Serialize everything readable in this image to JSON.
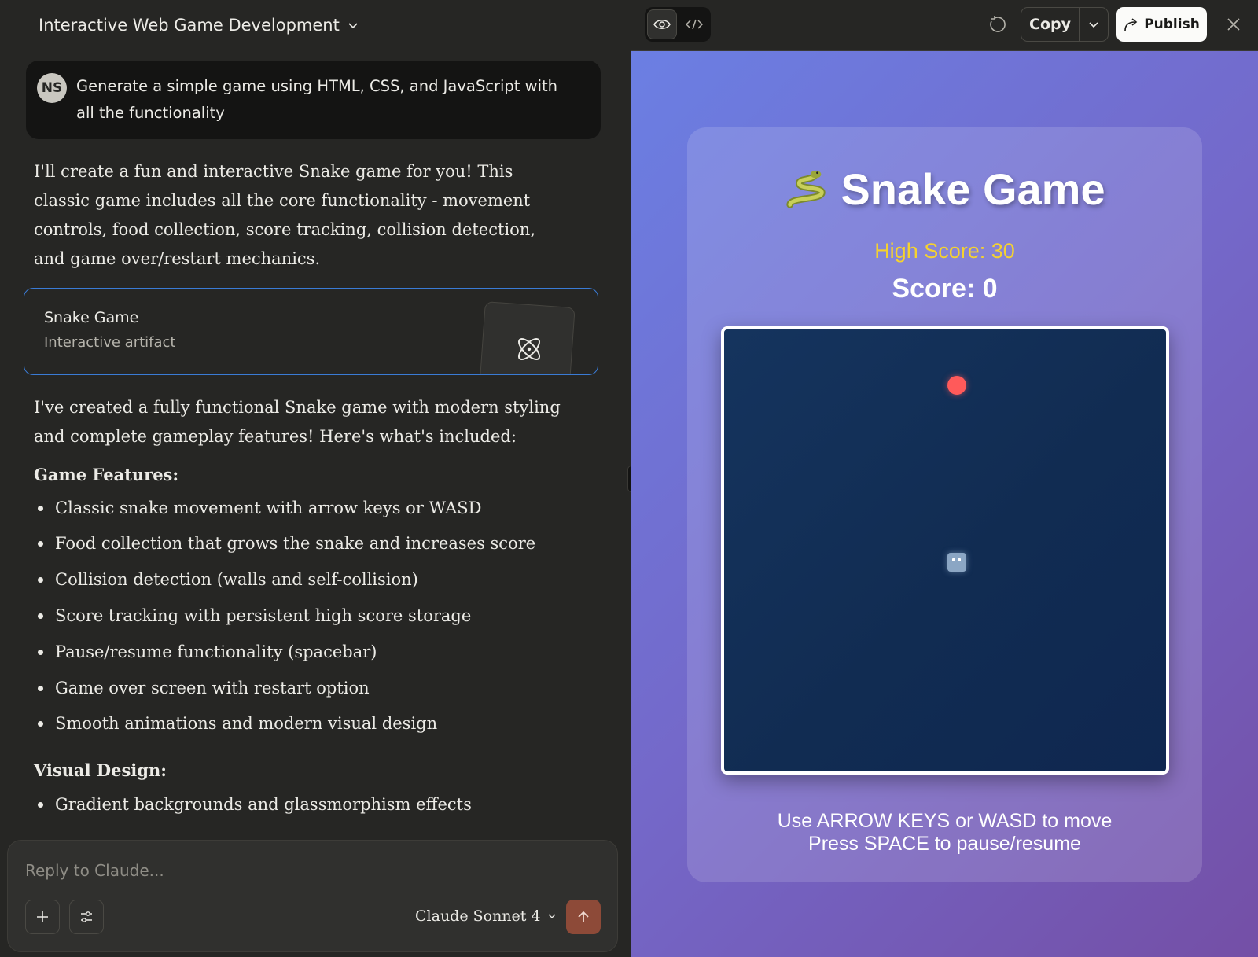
{
  "conversation": {
    "title": "Interactive Web Game Development",
    "user_initials": "NS",
    "user_message": "Generate a simple game using HTML, CSS, and JavaScript with all the functionality",
    "intro": "I'll create a fun and interactive Snake game for you! This classic game includes all the core functionality - movement controls, food collection, score tracking, collision detection, and game over/restart mechanics.",
    "artifact": {
      "title": "Snake Game",
      "subtitle": "Interactive artifact"
    },
    "summary": "I've created a fully functional Snake game with modern styling and complete gameplay features! Here's what's included:",
    "features_heading": "Game Features:",
    "features": [
      "Classic snake movement with arrow keys or WASD",
      "Food collection that grows the snake and increases score",
      "Collision detection (walls and self-collision)",
      "Score tracking with persistent high score storage",
      "Pause/resume functionality (spacebar)",
      "Game over screen with restart option",
      "Smooth animations and modern visual design"
    ],
    "visual_heading": "Visual Design:",
    "visual": [
      "Gradient backgrounds and glassmorphism effects"
    ]
  },
  "composer": {
    "placeholder": "Reply to Claude...",
    "model": "Claude Sonnet 4",
    "icons": {
      "add": "plus-icon",
      "settings": "sliders-icon",
      "send": "arrow-up-icon"
    }
  },
  "artifact_panel": {
    "copy_label": "Copy",
    "publish_label": "Publish",
    "icons": {
      "preview": "eye-icon",
      "code": "code-icon",
      "refresh": "refresh-icon",
      "close": "close-icon"
    }
  },
  "game": {
    "title": "Snake Game",
    "high_score": "High Score: 30",
    "score": "Score: 0",
    "instructions_line1": "Use ARROW KEYS or WASD to move",
    "instructions_line2": "Press SPACE to pause/resume",
    "colors": {
      "food": "#ff5a5a",
      "board": "#112c52",
      "high_score": "#f5d22f",
      "accent": "#3a7bd5",
      "send": "#8d4a38"
    }
  }
}
